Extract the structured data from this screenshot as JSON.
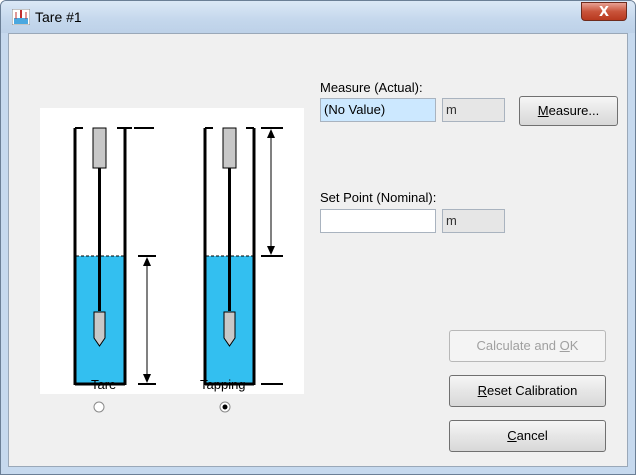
{
  "window": {
    "title": "Tare #1",
    "close_glyph": "X"
  },
  "measure": {
    "label": "Measure (Actual):",
    "value": "(No Value)",
    "unit": "m",
    "button_prefix": "M",
    "button_rest": "easure..."
  },
  "setpoint": {
    "label": "Set Point (Nominal):",
    "value": "",
    "unit": "m"
  },
  "buttons": {
    "calculate_prefix": "Calculate and ",
    "calculate_hotkey": "O",
    "calculate_rest": "K",
    "reset_hotkey": "R",
    "reset_rest": "eset Calibration",
    "cancel_hotkey": "C",
    "cancel_rest": "ancel"
  },
  "modes": [
    {
      "label": "Tare",
      "selected": false
    },
    {
      "label": "Tapping",
      "selected": true
    }
  ],
  "colors": {
    "water": "#33bff0",
    "field_selected": "#cce8ff",
    "close_button": "#c9543b"
  },
  "icons": [
    "app-icon",
    "close-icon",
    "radio-icon"
  ]
}
